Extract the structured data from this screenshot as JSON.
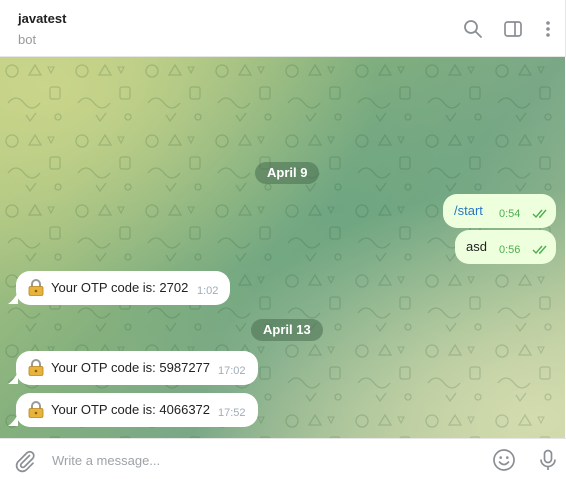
{
  "header": {
    "title": "javatest",
    "subtitle": "bot",
    "icons": [
      "search-icon",
      "sidebar-toggle-icon",
      "more-vertical-icon"
    ]
  },
  "messages": [
    {
      "type": "date",
      "text": "April 9"
    },
    {
      "type": "outgoing",
      "text": "/start",
      "time": "0:54",
      "status": "read"
    },
    {
      "type": "outgoing",
      "text": "asd",
      "time": "0:56",
      "status": "read"
    },
    {
      "type": "incoming",
      "icon": "lock-icon",
      "text": "Your OTP code is: 2702",
      "time": "1:02"
    },
    {
      "type": "date",
      "text": "April 13"
    },
    {
      "type": "incoming",
      "icon": "lock-icon",
      "text": "Your OTP code is: 5987277",
      "time": "17:02"
    },
    {
      "type": "incoming",
      "icon": "lock-icon",
      "text": "Your OTP code is: 4066372",
      "time": "17:52"
    }
  ],
  "composer": {
    "placeholder": "Write a message...",
    "value": "",
    "icons": [
      "attach-icon",
      "emoji-icon",
      "microphone-icon"
    ]
  },
  "colors": {
    "outgoing_bubble": "#eeffde",
    "incoming_bubble": "#ffffff",
    "link": "#2b78c2",
    "read_ticks": "#4fae4e"
  }
}
